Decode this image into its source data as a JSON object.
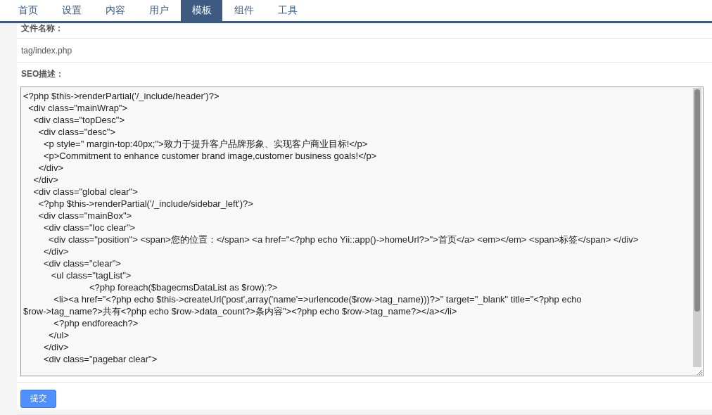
{
  "nav": {
    "tabs": [
      {
        "label": "首页",
        "selected": false
      },
      {
        "label": "设置",
        "selected": false
      },
      {
        "label": "内容",
        "selected": false
      },
      {
        "label": "用户",
        "selected": false
      },
      {
        "label": "模板",
        "selected": true
      },
      {
        "label": "组件",
        "selected": false
      },
      {
        "label": "工具",
        "selected": false
      }
    ]
  },
  "form": {
    "filename_label": "文件名称：",
    "filename": "tag/index.php",
    "seo_label": "SEO描述：",
    "code_lines": [
      "<?php $this->renderPartial('/_include/header')?>",
      "  <div class=\"mainWrap\">",
      "    <div class=\"topDesc\">",
      "      <div class=\"desc\">",
      "        <p style=\" margin-top:40px;\">致力于提升客户品牌形象、实现客户商业目标!</p>",
      "        <p>Commitment to enhance customer brand image,customer business goals!</p>",
      "      </div>",
      "    </div>",
      "    <div class=\"global clear\">",
      "      <?php $this->renderPartial('/_include/sidebar_left')?>",
      "      <div class=\"mainBox\">",
      "        <div class=\"loc clear\">",
      "          <div class=\"position\"> <span>您的位置：</span> <a href=\"<?php echo Yii::app()->homeUrl?>\">首页</a> <em></em> <span>标签</span> </div>",
      "        </div>",
      "        <div class=\"clear\">",
      "           <ul class=\"tagList\">",
      "                          <?php foreach($bagecmsDataList as $row):?>",
      "            <li><a href=\"<?php echo $this->createUrl('post',array('name'=>urlencode($row->tag_name)))?>\" target=\"_blank\" title=\"<?php echo",
      "$row->tag_name?>共有<?php echo $row->data_count?>条内容\"><?php echo $row->tag_name?></a></li>",
      "            <?php endforeach?>",
      "          </ul>",
      "        </div>",
      "        <div class=\"pagebar clear\">"
    ],
    "submit": "提交"
  }
}
